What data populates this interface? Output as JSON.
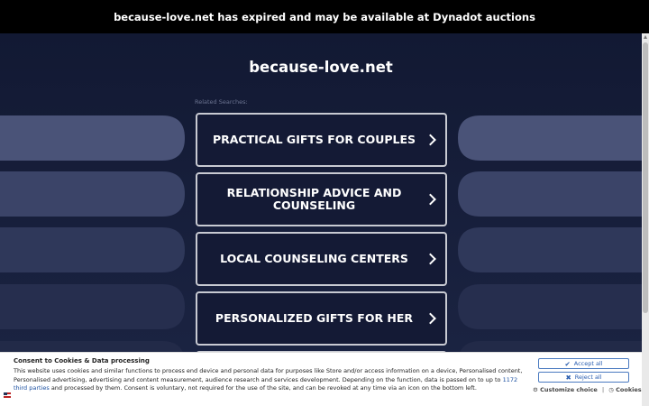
{
  "banner": {
    "text": "because-love.net has expired and may be available at Dynadot auctions"
  },
  "page": {
    "domain": "because-love.net",
    "related_label": "Related Searches:"
  },
  "searches": [
    {
      "label": "PRACTICAL GIFTS FOR COUPLES"
    },
    {
      "label": "RELATIONSHIP ADVICE AND COUNSELING"
    },
    {
      "label": "LOCAL COUNSELING CENTERS"
    },
    {
      "label": "PERSONALIZED GIFTS FOR HER"
    }
  ],
  "consent": {
    "title": "Consent to Cookies & Data processing",
    "body_part1": "This website uses cookies and similar functions to process end device and personal data for purposes like Store and/or access information on a device, Personalised content, Personalised advertising, advertising and content measurement, audience research and services development. Depending on the function, data is passed on to up to ",
    "body_link": "1172 third parties",
    "body_part2": " and processed by them. Consent is voluntary, not required for the use of the site, and can be revoked at any time via an icon on the bottom left.",
    "accept_label": "Accept all",
    "reject_label": "Reject all",
    "customize_label": "Customize choice",
    "cookies_label": "Cookies",
    "separator": "|"
  },
  "colors": {
    "background": "#151b33",
    "banner": "#000000",
    "button_border": "#c8cad2",
    "consent_accent": "#2a5eb0"
  }
}
